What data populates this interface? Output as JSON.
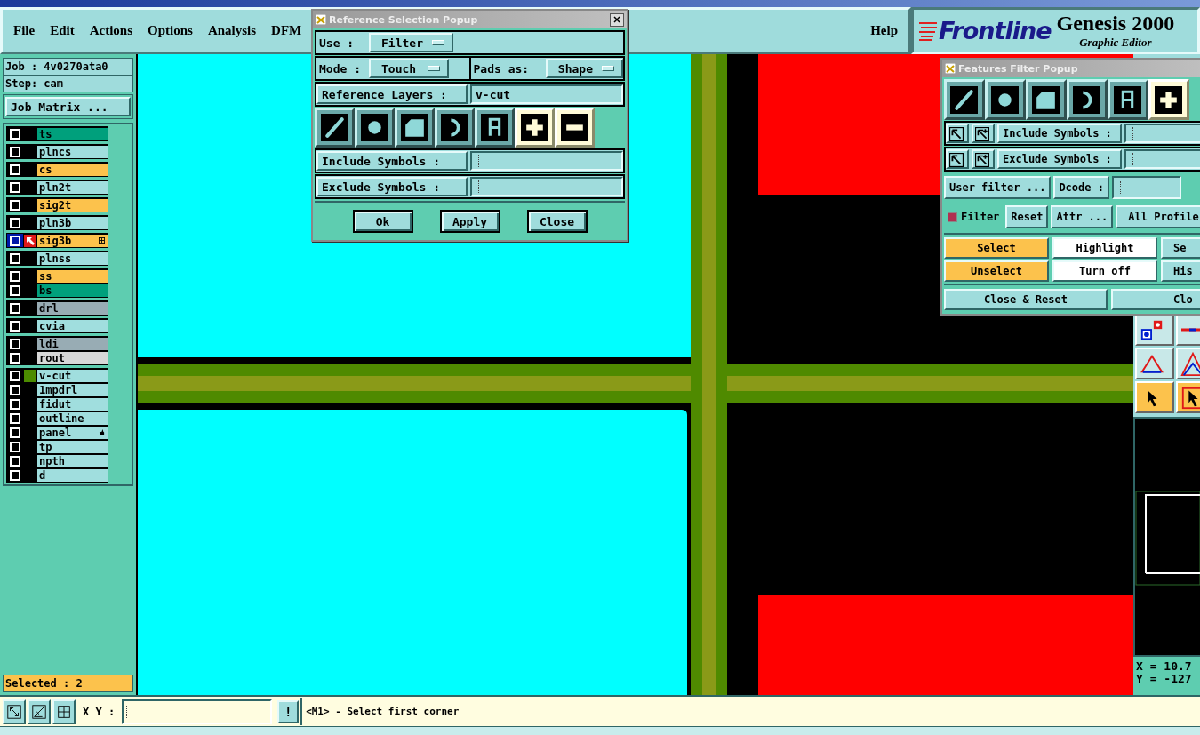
{
  "menu_bar": {
    "items": [
      "File",
      "Edit",
      "Actions",
      "Options",
      "Analysis",
      "DFM"
    ],
    "help": "Help"
  },
  "logo": {
    "brand": "Frontline",
    "product": "Genesis 2000",
    "subtitle": "Graphic Editor"
  },
  "job_panel": {
    "job": "Job : 4v0270ata0",
    "step": "Step: cam",
    "job_matrix_button": "Job Matrix ...",
    "layer_groups": [
      [
        {
          "name": "ts",
          "color": "#00a07c",
          "work": false,
          "displayed": false
        }
      ],
      [
        {
          "name": "plncs",
          "color": "#a0dede",
          "work": false,
          "displayed": false
        }
      ],
      [
        {
          "name": "cs",
          "color": "#fcc24c",
          "work": false,
          "displayed": false
        }
      ],
      [
        {
          "name": "pln2t",
          "color": "#a0dede",
          "work": false,
          "displayed": false
        }
      ],
      [
        {
          "name": "sig2t",
          "color": "#fcc24c",
          "work": false,
          "displayed": false
        }
      ],
      [
        {
          "name": "pln3b",
          "color": "#a0dede",
          "work": false,
          "displayed": false
        }
      ],
      [
        {
          "name": "sig3b",
          "color": "#fcc24c",
          "work": true,
          "displayed": false,
          "kind": "grid"
        }
      ],
      [
        {
          "name": "plnss",
          "color": "#a0dede",
          "work": false,
          "displayed": false
        }
      ],
      [
        {
          "name": "ss",
          "color": "#fcc24c",
          "work": false,
          "displayed": false
        },
        {
          "name": "bs",
          "color": "#00a07c",
          "work": false,
          "displayed": false
        }
      ],
      [
        {
          "name": "drl",
          "color": "#98acb4",
          "work": false,
          "displayed": false
        }
      ],
      [
        {
          "name": "cvia",
          "color": "#a0dede",
          "work": false,
          "displayed": false
        }
      ],
      [
        {
          "name": "ldi",
          "color": "#98acb4",
          "work": false,
          "displayed": false
        },
        {
          "name": "rout",
          "color": "#d8d8d8",
          "work": false,
          "displayed": false
        }
      ],
      [
        {
          "name": "v-cut",
          "color": "#a0dede",
          "work": false,
          "displayed": true
        },
        {
          "name": "1mpdrl",
          "color": "#a0dede",
          "work": false,
          "displayed": false
        },
        {
          "name": "fidut",
          "color": "#a0dede",
          "work": false,
          "displayed": false
        },
        {
          "name": "outline",
          "color": "#a0dede",
          "work": false,
          "displayed": false
        },
        {
          "name": "panel",
          "color": "#a0dede",
          "work": false,
          "displayed": false,
          "kind": "hand"
        },
        {
          "name": "tp",
          "color": "#a0dede",
          "work": false,
          "displayed": false
        },
        {
          "name": "npth",
          "color": "#a0dede",
          "work": false,
          "displayed": false
        },
        {
          "name": "d",
          "color": "#a0dede",
          "work": false,
          "displayed": false
        }
      ]
    ],
    "selected_count": "Selected : 2"
  },
  "reference_popup": {
    "title": "Reference Selection Popup",
    "use_label": "Use  :",
    "use_value": "Filter",
    "mode_label": "Mode :",
    "mode_value": "Touch",
    "pads_label": "Pads as:",
    "pads_value": "Shape",
    "layers_button": "Reference Layers :",
    "layers_value": "v-cut",
    "feature_buttons": [
      {
        "kind": "line",
        "selected": true
      },
      {
        "kind": "pad",
        "selected": true
      },
      {
        "kind": "surface",
        "selected": true
      },
      {
        "kind": "arc",
        "selected": true
      },
      {
        "kind": "text",
        "selected": true
      },
      {
        "kind": "plus",
        "selected": true
      },
      {
        "kind": "minus",
        "selected": true
      }
    ],
    "include_button": "Include Symbols :",
    "exclude_button": "Exclude Symbols :",
    "buttons": [
      "Ok",
      "Apply",
      "Close"
    ]
  },
  "features_popup": {
    "title": "Features Filter Popup",
    "feature_buttons": [
      {
        "kind": "line",
        "selected": true
      },
      {
        "kind": "pad",
        "selected": true
      },
      {
        "kind": "surface",
        "selected": true
      },
      {
        "kind": "arc",
        "selected": true
      },
      {
        "kind": "text",
        "selected": true
      },
      {
        "kind": "plus",
        "selected": true
      }
    ],
    "include_button": "Include Symbols :",
    "exclude_button": "Exclude Symbols :",
    "user_filter_button": "User filter ...",
    "dcode_button": "Dcode :",
    "filter_checkbox": {
      "label": "Filter",
      "checked": true
    },
    "reset_button": "Reset",
    "attr_button": "Attr ...",
    "profile_value": "All Profile",
    "action_rows": [
      [
        "Select",
        "Highlight",
        "Se"
      ],
      [
        "Unselect",
        "Turn off",
        "His"
      ]
    ],
    "close_buttons": [
      "Close & Reset",
      "Clo"
    ]
  },
  "coordinates": {
    "x": "X = 10.7",
    "y": "Y = -127"
  },
  "command_bar": {
    "xy_label": "X Y :",
    "alert_button": "!",
    "message": "<M1> - Select first corner"
  }
}
